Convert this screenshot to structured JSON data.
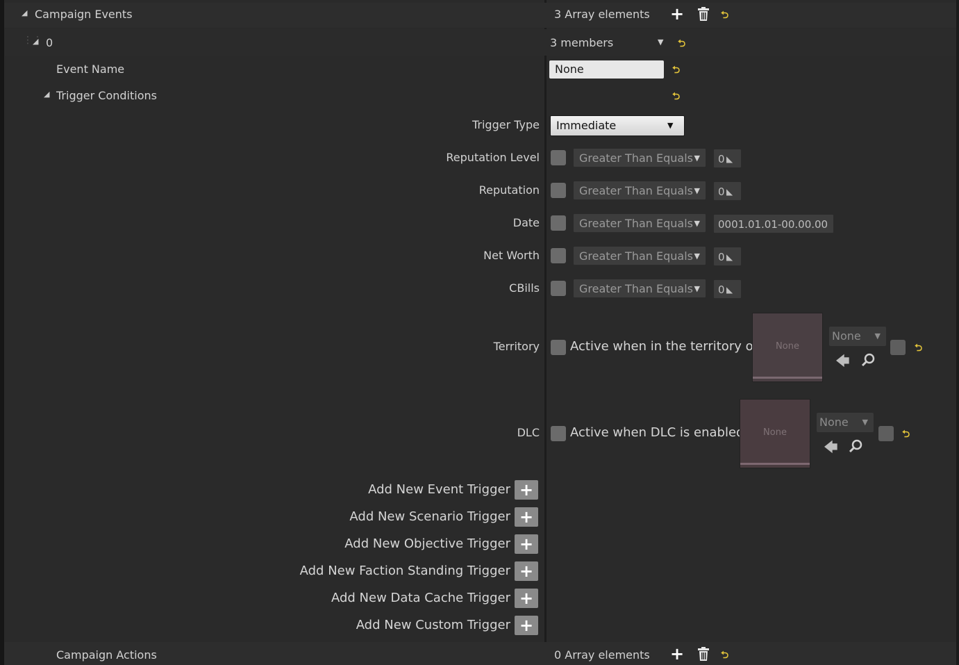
{
  "campaign_events": {
    "label": "Campaign Events",
    "count": "3 Array elements",
    "add_icon": "plus-icon",
    "delete_icon": "trash-icon",
    "reset_icon": "reset-arrow-icon"
  },
  "element0": {
    "index": "0",
    "members": "3 members"
  },
  "event_name": {
    "label": "Event Name",
    "value": "None"
  },
  "trigger_conditions": {
    "label": "Trigger Conditions"
  },
  "trigger_type": {
    "label": "Trigger Type",
    "value": "Immediate"
  },
  "conditions": [
    {
      "label": "Reputation Level",
      "operator": "Greater Than Equals",
      "value": "0"
    },
    {
      "label": "Reputation",
      "operator": "Greater Than Equals",
      "value": "0"
    },
    {
      "label": "Date",
      "operator": "Greater Than Equals",
      "value": "0001.01.01-00.00.00"
    },
    {
      "label": "Net Worth",
      "operator": "Greater Than Equals",
      "value": "0"
    },
    {
      "label": "CBills",
      "operator": "Greater Than Equals",
      "value": "0"
    }
  ],
  "territory": {
    "label": "Territory",
    "checkbox_label": "Active when in the territory of",
    "thumb_text": "None",
    "combo_value": "None"
  },
  "dlc": {
    "label": "DLC",
    "checkbox_label": "Active when DLC is enabled",
    "thumb_text": "None",
    "combo_value": "None"
  },
  "add_buttons": [
    {
      "label": "Add New Event Trigger"
    },
    {
      "label": "Add New Scenario Trigger"
    },
    {
      "label": "Add New Objective Trigger"
    },
    {
      "label": "Add New Faction Standing Trigger"
    },
    {
      "label": "Add New Data Cache Trigger"
    },
    {
      "label": "Add New Custom Trigger"
    }
  ],
  "campaign_actions": {
    "label": "Campaign Actions",
    "count": "0 Array elements"
  },
  "colors": {
    "background": "#2a2a2a",
    "reset_accent": "#e3c43a"
  }
}
